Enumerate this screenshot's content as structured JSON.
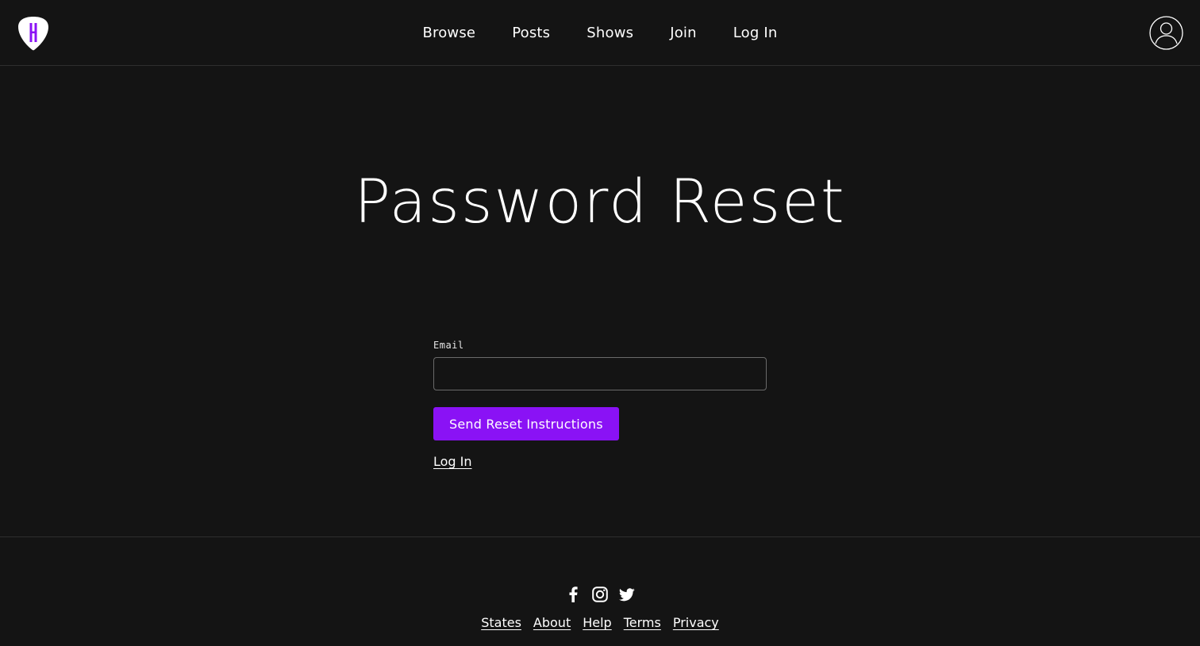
{
  "header": {
    "nav": [
      {
        "label": "Browse"
      },
      {
        "label": "Posts"
      },
      {
        "label": "Shows"
      },
      {
        "label": "Join"
      },
      {
        "label": "Log In"
      }
    ],
    "logo_icon": "guitar-pick-logo",
    "avatar_icon": "user-circle-icon"
  },
  "main": {
    "title": "Password Reset",
    "form": {
      "email_label": "Email",
      "email_value": "",
      "email_placeholder": "",
      "submit_label": "Send Reset Instructions",
      "login_link": "Log In"
    }
  },
  "footer": {
    "socials": [
      "facebook-icon",
      "instagram-icon",
      "twitter-icon"
    ],
    "links": [
      {
        "label": "States"
      },
      {
        "label": "About"
      },
      {
        "label": "Help"
      },
      {
        "label": "Terms"
      },
      {
        "label": "Privacy"
      }
    ]
  },
  "colors": {
    "background": "#141414",
    "accent": "#8a12f5",
    "text": "#ffffff",
    "divider": "#2e2e2e"
  }
}
